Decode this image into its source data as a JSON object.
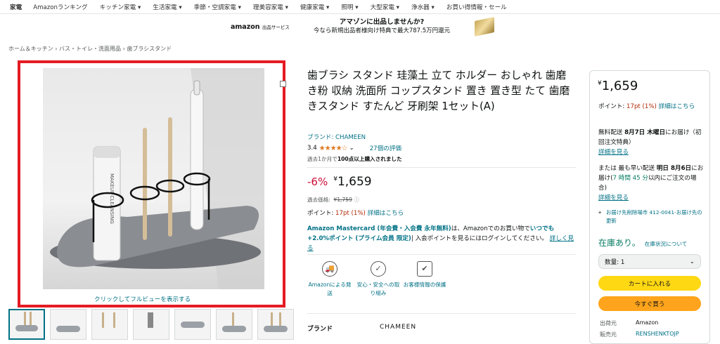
{
  "nav": {
    "items": [
      "家電",
      "Amazonランキング",
      "キッチン家電 ▾",
      "生活家電 ▾",
      "季節・空調家電 ▾",
      "理美容家電 ▾",
      "健康家電 ▾",
      "照明 ▾",
      "大型家電 ▾",
      "浄水器 ▾",
      "お買い得情報・セール"
    ]
  },
  "banner": {
    "logo": "amazon",
    "logo_sub": "出品サービス",
    "line1": "アマゾンに出品しませんか?",
    "line2": "今なら新規出品者様向け特典で最大787.5万円還元"
  },
  "breadcrumb": "ホーム＆キッチン › バス・トイレ・洗面用品 › 歯ブラシスタンド",
  "image": {
    "preview_link": "クリックしてフルビューを表示する",
    "tube_text": "MAKEUP CLEANSING"
  },
  "product": {
    "title": "歯ブラシ スタンド 珪藻土 立て ホルダー おしゃれ 歯磨き粉 収納 洗面所 コップスタンド 置き 置き型 たて 歯磨 きスタンド すたんど 牙刷架 1セット(A)",
    "brand": "ブランド: CHAMEEN",
    "rating": "3.4",
    "stars": "★★★★☆",
    "chevron": "⌄",
    "review_count": "27個の評価",
    "bought_pre": "過去1か月で",
    "bought_bold": "100点以上購入されました",
    "discount": "-6%",
    "price_symbol": "¥",
    "price": "1,659",
    "past_label": "過去価格:",
    "past_price": "¥1,759",
    "points_label": "ポイント:",
    "points": "17pt",
    "points_pct": "(1%)",
    "points_link": "詳細はこちら",
    "card_bold": "Amazon Mastercard (年会費・入会費 永年無料)",
    "card_mid": "は、Amazonでのお買い物で",
    "card_bold2": "いつでも+2.0%ポイント (プライム会員 限定)",
    "card_tail": "| 入会ポイントを見るにはログインしてください。",
    "card_link": "詳しく見る",
    "features": [
      {
        "icon": "delivery-truck-icon",
        "glyph": "🚚",
        "label": "Amazonによる発送"
      },
      {
        "icon": "secure-badge-icon",
        "glyph": "✓",
        "label": "安心・安全への取り組み"
      },
      {
        "icon": "secure-bag-icon",
        "glyph": "✔",
        "label": "お客様情報の保護"
      }
    ],
    "spec_key": "ブランド",
    "spec_val": "CHAMEEN"
  },
  "buybox": {
    "price_symbol": "¥",
    "price": "1,659",
    "points_label": "ポイント:",
    "points": "17pt",
    "points_pct": "(1%)",
    "points_link": "詳細はこちら",
    "ship1": "無料配送",
    "ship1_date": "8月7日 木曜日",
    "ship1_tail": "にお届け（初回注文特典）",
    "ship1_link": "詳細を見る",
    "ship2": "または 最も早い配送",
    "ship2_date": "明日 8月6日",
    "ship2_mid": "にお届け(",
    "ship2_time": "7 時間 45 分",
    "ship2_tail": "以内にご注文の場合)",
    "ship2_link": "詳細を見る",
    "address": "お届け先削除場市 412-0041-お届け先の更新",
    "stock": "在庫あり。",
    "stock_link": "在庫状況について",
    "qty": "数量: 1",
    "add_cart": "カートに入れる",
    "buy_now": "今すぐ買う",
    "shipper_label": "出荷元",
    "shipper": "Amazon",
    "seller_label": "販売元",
    "seller": "RENSHENKTOJP"
  },
  "colors": {
    "accent": "#007185",
    "price_red": "#cc0c39",
    "stock_green": "#067d62",
    "cart": "#ffd814",
    "buy": "#ffa41c",
    "highlight": "#e51b23"
  }
}
